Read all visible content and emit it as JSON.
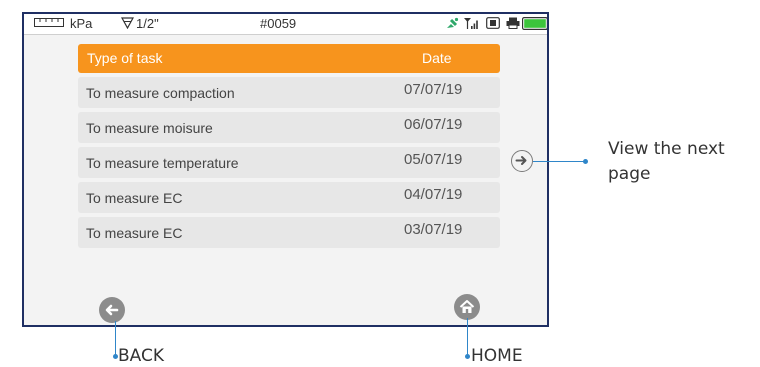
{
  "status_bar": {
    "unit": "kPa",
    "cone_size": "1/2\"",
    "record_id": "#0059"
  },
  "table": {
    "headers": {
      "task": "Type of task",
      "date": "Date"
    },
    "rows": [
      {
        "task": "To measure compaction",
        "date": "07/07/19"
      },
      {
        "task": "To measure moisure",
        "date": "06/07/19"
      },
      {
        "task": "To measure temperature",
        "date": "05/07/19"
      },
      {
        "task": "To measure EC",
        "date": "04/07/19"
      },
      {
        "task": "To measure EC",
        "date": "03/07/19"
      }
    ]
  },
  "annotations": {
    "next_page_line1": "View the next",
    "next_page_line2": "page",
    "back": "BACK",
    "home": "HOME"
  },
  "colors": {
    "header": "#f7941d",
    "row": "#e7e7e7",
    "frame": "#1f2f63",
    "callout": "#2f86c9",
    "button": "#8c8c8c",
    "battery": "#3cc43c"
  },
  "icons": [
    "ruler-icon",
    "funnel-icon",
    "satellite-icon",
    "signal-icon",
    "sim-card-icon",
    "printer-icon",
    "battery-icon",
    "arrow-right-icon",
    "arrow-left-icon",
    "home-icon"
  ]
}
